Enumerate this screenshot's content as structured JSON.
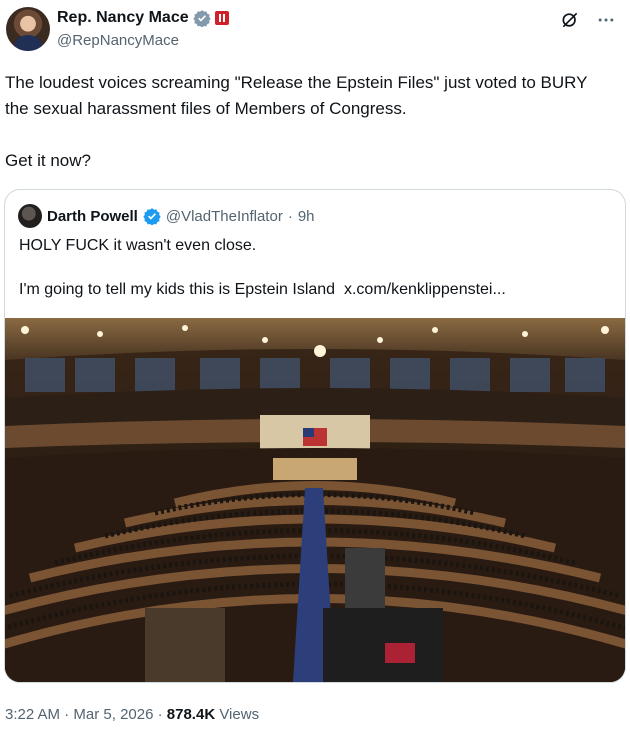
{
  "post": {
    "author_name": "Rep. Nancy Mace",
    "author_handle": "@RepNancyMace",
    "paragraphs": [
      "The loudest voices screaming \"Release the Epstein Files\" just voted to BURY the sexual harassment files of Members of Congress.",
      "Get it now?"
    ],
    "time": "3:22 AM",
    "date": "Mar 5, 2026",
    "views_count": "878.4K",
    "views_label": "Views",
    "separator": "·"
  },
  "quoted": {
    "author_name": "Darth Powell",
    "author_handle": "@VladTheInflator",
    "age": "9h",
    "separator": "·",
    "line1": "HOLY FUCK it wasn't even close.",
    "line2": "I'm going to tell my kids this is Epstein Island",
    "link": "x.com/kenklippenstei...",
    "image_alt": "House chamber photo"
  },
  "icons": {
    "verified": "verified-badge-icon",
    "flag": "house-flag-icon",
    "grok": "grok-icon",
    "more": "more-icon"
  },
  "colors": {
    "verified_blue": "#1d9bf0",
    "secondary_text": "#536471",
    "border": "#cfd9de"
  }
}
